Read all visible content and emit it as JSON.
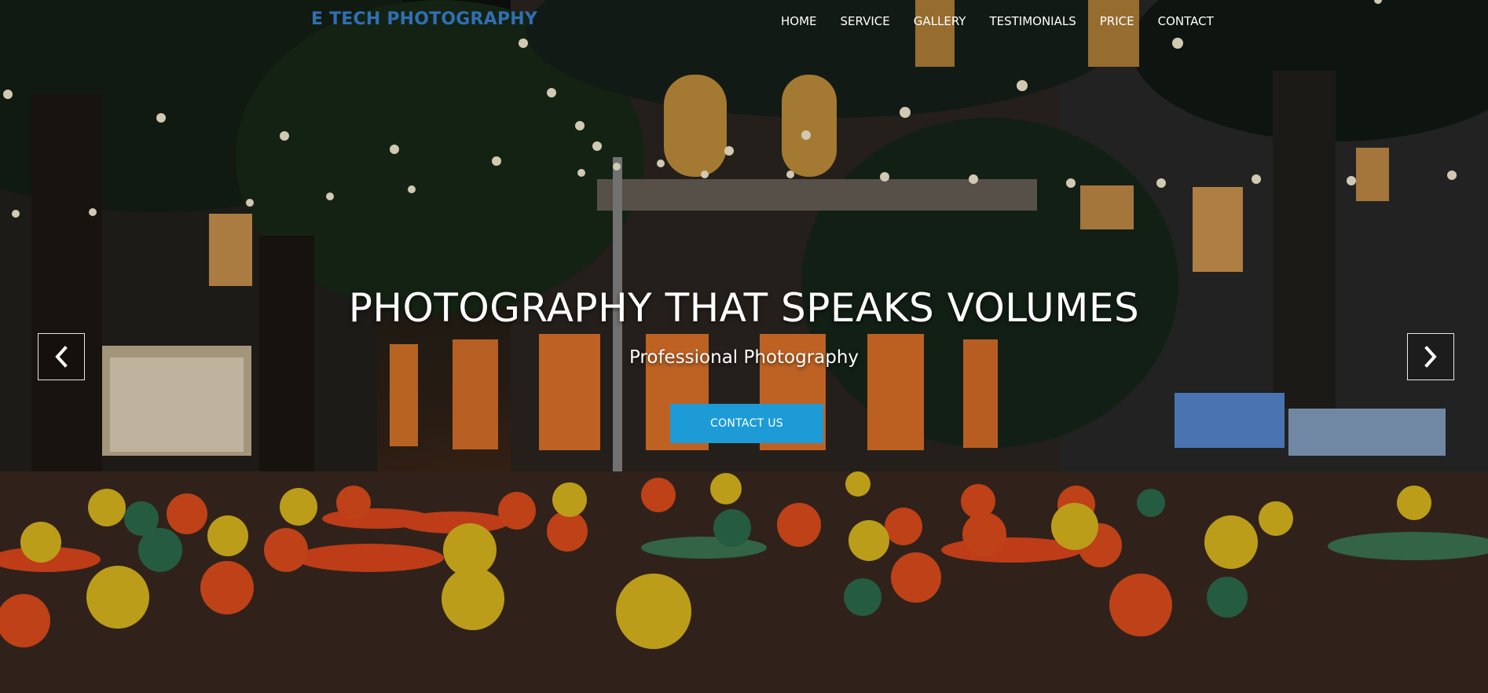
{
  "brand": "E TECH PHOTOGRAPHY",
  "nav": {
    "items": [
      {
        "label": "HOME"
      },
      {
        "label": "SERVICE"
      },
      {
        "label": "GALLERY"
      },
      {
        "label": "TESTIMONIALS"
      },
      {
        "label": "PRICE"
      },
      {
        "label": "CONTACT"
      }
    ]
  },
  "hero": {
    "title": "PHOTOGRAPHY THAT SPEAKS VOLUMES",
    "subtitle": "Professional Photography",
    "cta_label": "CONTACT US"
  },
  "carousel": {
    "prev_icon": "chevron-left-icon",
    "next_icon": "chevron-right-icon"
  },
  "colors": {
    "brand": "#2f6fb3",
    "cta": "#1d9bd6",
    "nav_text": "#ffffff"
  }
}
